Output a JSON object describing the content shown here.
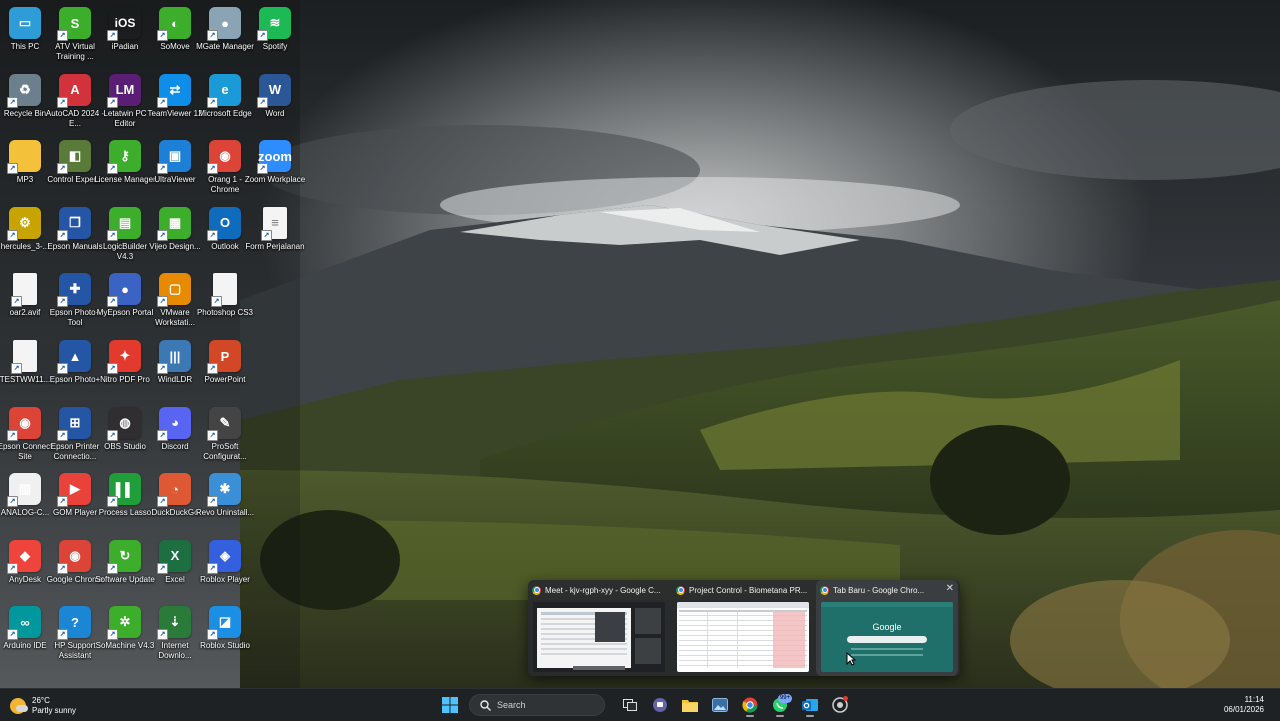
{
  "desktop": {
    "icons": [
      {
        "label": "This PC",
        "glyph": "▭",
        "color": "#2e9cd6",
        "name": "this-pc",
        "col": 0,
        "row": 0
      },
      {
        "label": "ATV Virtual Training ...",
        "glyph": "S",
        "color": "#3dae2b",
        "name": "atv-virtual-training",
        "col": 1,
        "row": 0
      },
      {
        "label": "iPadian",
        "glyph": "iOS",
        "color": "transparent",
        "name": "ipadian",
        "col": 2,
        "row": 0
      },
      {
        "label": "SoMove",
        "glyph": "◐",
        "color": "#3dae2b",
        "name": "somove",
        "col": 3,
        "row": 0
      },
      {
        "label": "MGate Manager",
        "glyph": "●",
        "color": "#8aa3b5",
        "name": "mgate-manager",
        "col": 4,
        "row": 0
      },
      {
        "label": "Spotify",
        "glyph": "≋",
        "color": "#1db954",
        "name": "spotify",
        "col": 5,
        "row": 0
      },
      {
        "label": "Recycle Bin",
        "glyph": "♻",
        "color": "#6b7f8c",
        "name": "recycle-bin",
        "col": 0,
        "row": 1
      },
      {
        "label": "AutoCAD 2024 - E...",
        "glyph": "A",
        "color": "#d2323c",
        "name": "autocad-2024",
        "col": 1,
        "row": 1
      },
      {
        "label": "Letatwin PC Editor",
        "glyph": "LM",
        "color": "#5a1f74",
        "name": "letatwin-pc-editor",
        "col": 2,
        "row": 1
      },
      {
        "label": "TeamViewer 12",
        "glyph": "⇄",
        "color": "#0e8ee9",
        "name": "teamviewer-12",
        "col": 3,
        "row": 1
      },
      {
        "label": "Microsoft Edge",
        "glyph": "e",
        "color": "#1a9bd7",
        "name": "microsoft-edge",
        "col": 4,
        "row": 1
      },
      {
        "label": "Word",
        "glyph": "W",
        "color": "#2b5797",
        "name": "word",
        "col": 5,
        "row": 1
      },
      {
        "label": "MP3",
        "glyph": "",
        "color": "#f3c13a",
        "name": "mp3-folder",
        "col": 0,
        "row": 2
      },
      {
        "label": "Control Exper...",
        "glyph": "◧",
        "color": "#5a7a3a",
        "name": "control-expert",
        "col": 1,
        "row": 2
      },
      {
        "label": "License Manager",
        "glyph": "⚷",
        "color": "#3dae2b",
        "name": "license-manager",
        "col": 2,
        "row": 2
      },
      {
        "label": "UltraViewer",
        "glyph": "▣",
        "color": "#1e7fd6",
        "name": "ultraviewer",
        "col": 3,
        "row": 2
      },
      {
        "label": "Orang 1 - Chrome",
        "glyph": "◉",
        "color": "#db4437",
        "name": "orang-1-chrome",
        "col": 4,
        "row": 2
      },
      {
        "label": "Zoom Workplace",
        "glyph": "zoom",
        "color": "#2d8cff",
        "name": "zoom-workplace",
        "col": 5,
        "row": 2
      },
      {
        "label": "hercules_3-...",
        "glyph": "⚙",
        "color": "#c8a400",
        "name": "hercules",
        "col": 0,
        "row": 3
      },
      {
        "label": "Epson Manuals",
        "glyph": "❐",
        "color": "#2456a5",
        "name": "epson-manuals",
        "col": 1,
        "row": 3
      },
      {
        "label": "LogicBuilder V4.3",
        "glyph": "▤",
        "color": "#3dae2b",
        "name": "logicbuilder",
        "col": 2,
        "row": 3
      },
      {
        "label": "Vijeo Design...",
        "glyph": "▦",
        "color": "#3dae2b",
        "name": "vijeo-designer",
        "col": 3,
        "row": 3
      },
      {
        "label": "Outlook",
        "glyph": "O",
        "color": "#0f6cbd",
        "name": "outlook",
        "col": 4,
        "row": 3
      },
      {
        "label": "Form Perjalanan",
        "glyph": "≡",
        "color": "file",
        "name": "form-perjalanan",
        "col": 5,
        "row": 3
      },
      {
        "label": "oar2.avif",
        "glyph": "",
        "color": "file",
        "name": "oar2-avif",
        "col": 0,
        "row": 4
      },
      {
        "label": "Epson Photo+ Tool",
        "glyph": "✚",
        "color": "#2456a5",
        "name": "epson-photo-tool",
        "col": 1,
        "row": 4
      },
      {
        "label": "MyEpson Portal",
        "glyph": "●",
        "color": "#3b63c4",
        "name": "myepson-portal",
        "col": 2,
        "row": 4
      },
      {
        "label": "VMware Workstati...",
        "glyph": "▢",
        "color": "#e68a00",
        "name": "vmware-workstation",
        "col": 3,
        "row": 4
      },
      {
        "label": "Photoshop CS3",
        "glyph": "",
        "color": "file",
        "name": "photoshop-cs3",
        "col": 4,
        "row": 4
      },
      {
        "label": "TESTWW11...",
        "glyph": "",
        "color": "file",
        "name": "testww11",
        "col": 0,
        "row": 5
      },
      {
        "label": "Epson Photo+",
        "glyph": "▲",
        "color": "#2456a5",
        "name": "epson-photo-plus",
        "col": 1,
        "row": 5
      },
      {
        "label": "Nitro PDF Pro",
        "glyph": "✦",
        "color": "#e23b2e",
        "name": "nitro-pdf-pro",
        "col": 2,
        "row": 5
      },
      {
        "label": "WindLDR",
        "glyph": "|||",
        "color": "#3c78b4",
        "name": "windldr",
        "col": 3,
        "row": 5
      },
      {
        "label": "PowerPoint",
        "glyph": "P",
        "color": "#d24726",
        "name": "powerpoint",
        "col": 4,
        "row": 5
      },
      {
        "label": "Epson Connect Site",
        "glyph": "◉",
        "color": "#db4437",
        "name": "epson-connect-site",
        "col": 0,
        "row": 6
      },
      {
        "label": "Epson Printer Connectio...",
        "glyph": "⊞",
        "color": "#2456a5",
        "name": "epson-printer-connection",
        "col": 1,
        "row": 6
      },
      {
        "label": "OBS Studio",
        "glyph": "◍",
        "color": "#302e31",
        "name": "obs-studio",
        "col": 2,
        "row": 6
      },
      {
        "label": "Discord",
        "glyph": "◕",
        "color": "#5865f2",
        "name": "discord",
        "col": 3,
        "row": 6
      },
      {
        "label": "ProSoft Configurat...",
        "glyph": "✎",
        "color": "#444",
        "name": "prosoft-configurator",
        "col": 4,
        "row": 6
      },
      {
        "label": "ANALOG-C...",
        "glyph": "▥",
        "color": "#f0f0f0",
        "name": "analog-c",
        "col": 0,
        "row": 7
      },
      {
        "label": "GOM Player",
        "glyph": "▶",
        "color": "#e8423b",
        "name": "gom-player",
        "col": 1,
        "row": 7
      },
      {
        "label": "Process Lasso",
        "glyph": "▌▌",
        "color": "#1f9e3a",
        "name": "process-lasso",
        "col": 2,
        "row": 7
      },
      {
        "label": "DuckDuckGo",
        "glyph": "◔",
        "color": "#de5833",
        "name": "duckduckgo",
        "col": 3,
        "row": 7
      },
      {
        "label": "Revo Uninstall...",
        "glyph": "✱",
        "color": "#3b8fd6",
        "name": "revo-uninstaller",
        "col": 4,
        "row": 7
      },
      {
        "label": "AnyDesk",
        "glyph": "◆",
        "color": "#ef443b",
        "name": "anydesk",
        "col": 0,
        "row": 8
      },
      {
        "label": "Google Chrome",
        "glyph": "◉",
        "color": "#db4437",
        "name": "google-chrome",
        "col": 1,
        "row": 8
      },
      {
        "label": "Software Update",
        "glyph": "↻",
        "color": "#3dae2b",
        "name": "software-update",
        "col": 2,
        "row": 8
      },
      {
        "label": "Excel",
        "glyph": "X",
        "color": "#1d6f42",
        "name": "excel",
        "col": 3,
        "row": 8
      },
      {
        "label": "Roblox Player",
        "glyph": "◈",
        "color": "#3460e0",
        "name": "roblox-player",
        "col": 4,
        "row": 8
      },
      {
        "label": "Arduino IDE",
        "glyph": "∞",
        "color": "#00979d",
        "name": "arduino-ide",
        "col": 0,
        "row": 9
      },
      {
        "label": "HP Support Assistant",
        "glyph": "?",
        "color": "#1b86d4",
        "name": "hp-support-assistant",
        "col": 1,
        "row": 9
      },
      {
        "label": "SoMachine V4.3",
        "glyph": "✲",
        "color": "#3dae2b",
        "name": "somachine",
        "col": 2,
        "row": 9
      },
      {
        "label": "Internet Downlo...",
        "glyph": "⇣",
        "color": "#2a7a3a",
        "name": "internet-download-manager",
        "col": 3,
        "row": 9
      },
      {
        "label": "Roblox Studio",
        "glyph": "◪",
        "color": "#1a8fe3",
        "name": "roblox-studio",
        "col": 4,
        "row": 9
      }
    ]
  },
  "taskbar": {
    "weather": {
      "temp": "26°C",
      "desc": "Partly sunny"
    },
    "search": {
      "placeholder": "Search"
    },
    "clock": {
      "time": "11:14",
      "date": "06/01/2026"
    },
    "whatsapp_badge": "99+"
  },
  "thumbnails": [
    {
      "title": "Meet - kjv-rgph-xyy - Google C..."
    },
    {
      "title": "Project Control - Biometana PR..."
    },
    {
      "title": "Tab Baru - Google Chro..."
    }
  ],
  "google_logo": "Google"
}
